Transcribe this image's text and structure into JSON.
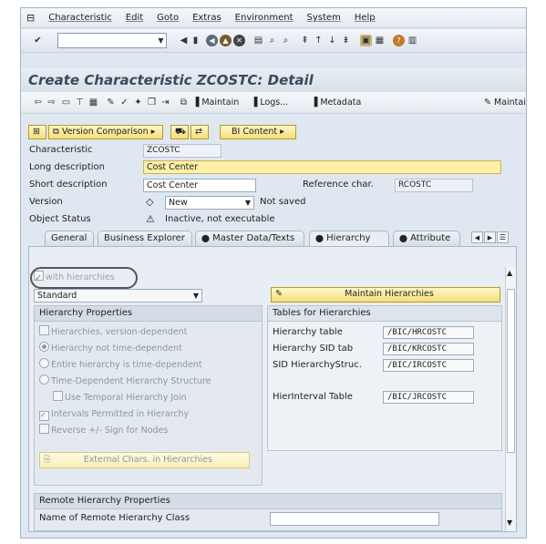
{
  "menu": [
    "Characteristic",
    "Edit",
    "Goto",
    "Extras",
    "Environment",
    "System",
    "Help"
  ],
  "page_title": "Create Characteristic ZCOSTC: Detail",
  "appbar": {
    "maintain": "Maintain",
    "logs": "Logs...",
    "metadata": "Metadata",
    "maintain2": "Maintai"
  },
  "buttons": {
    "version_comparison": "Version Comparison",
    "bi_content": "BI Content"
  },
  "fields": {
    "characteristic_label": "Characteristic",
    "characteristic_value": "ZCOSTC",
    "long_desc_label": "Long description",
    "long_desc_value": "Cost Center",
    "short_desc_label": "Short description",
    "short_desc_value": "Cost Center",
    "ref_char_label": "Reference char.",
    "ref_char_value": "RCOSTC",
    "version_label": "Version",
    "version_value": "New",
    "version_status": "Not saved",
    "object_status_label": "Object Status",
    "object_status_value": "Inactive, not executable"
  },
  "tabs": [
    "General",
    "Business Explorer",
    "Master Data/Texts",
    "Hierarchy",
    "Attribute"
  ],
  "hierarchy": {
    "with_hierarchies": "with hierarchies",
    "type_value": "Standard",
    "properties_title": "Hierarchy Properties",
    "options": [
      "Hierarchies, version-dependent",
      "Hierarchy not time-dependent",
      "Entire hierarchy is time-dependent",
      "Time-Dependent Hierarchy Structure",
      "Use Temporal Hierarchy Join",
      "Intervals Permitted in Hierarchy",
      "Reverse +/- Sign for Nodes"
    ],
    "external_chars": "External Chars. in Hierarchies",
    "maintain_hierarchies": "Maintain Hierarchies",
    "tables_title": "Tables for Hierarchies",
    "tables": [
      {
        "label": "Hierarchy table",
        "value": "/BIC/HRCOSTC"
      },
      {
        "label": "Hierarchy SID tab",
        "value": "/BIC/KRCOSTC"
      },
      {
        "label": "SID HierarchyStruc.",
        "value": "/BIC/IRCOSTC"
      },
      {
        "label": "HierInterval Table",
        "value": "/BIC/JRCOSTC"
      }
    ],
    "remote_title": "Remote Hierarchy Properties",
    "remote_class_label": "Name of Remote Hierarchy Class"
  }
}
